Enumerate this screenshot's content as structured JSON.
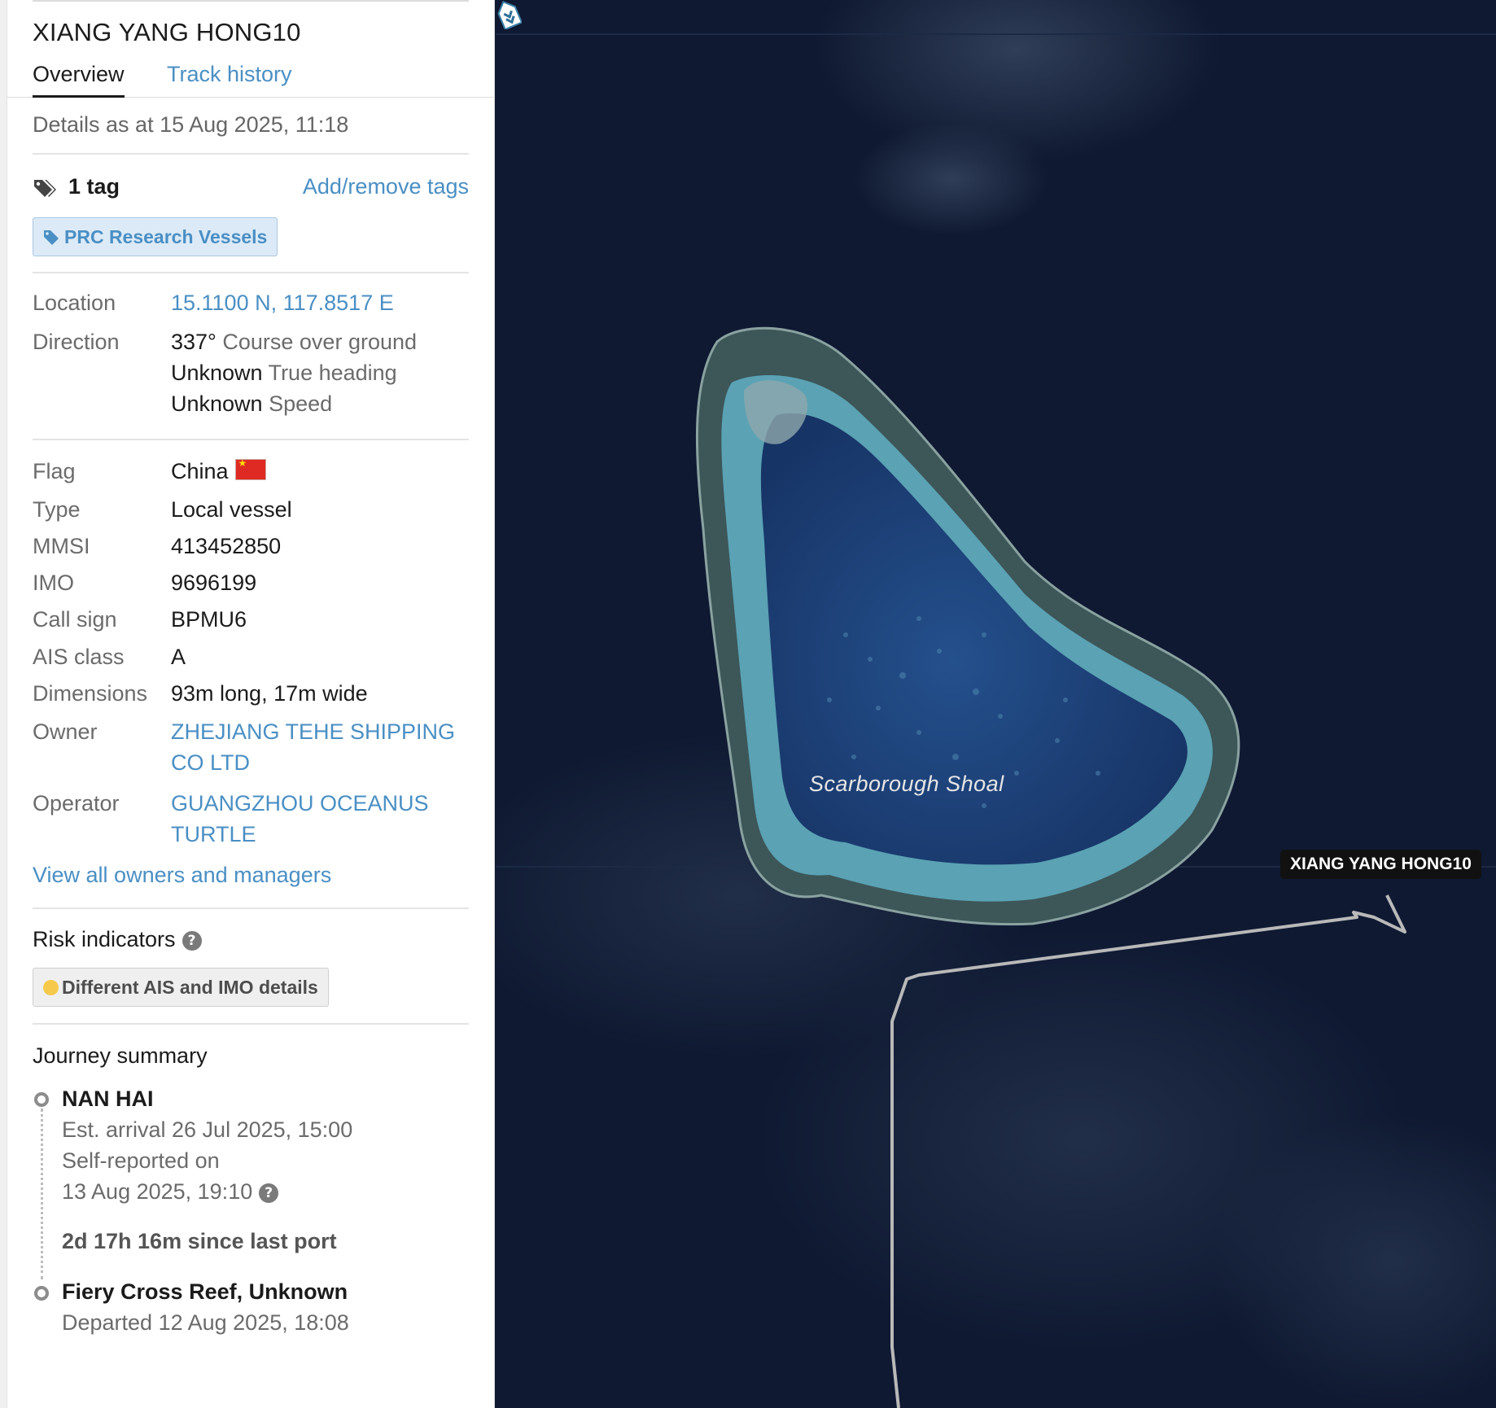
{
  "vessel": {
    "name": "XIANG YANG HONG10"
  },
  "tabs": [
    {
      "label": "Overview",
      "active": true
    },
    {
      "label": "Track history",
      "active": false
    }
  ],
  "details_as": "Details as at 15 Aug 2025, 11:18",
  "tags": {
    "count_label": "1 tag",
    "manage_link": "Add/remove tags",
    "items": [
      "PRC Research Vessels"
    ],
    "icon": "tag-icon"
  },
  "location": {
    "label": "Location",
    "value": "15.1100 N, 117.8517 E"
  },
  "direction": {
    "label": "Direction",
    "course_value": "337°",
    "course_label": "Course over ground",
    "heading_value": "Unknown",
    "heading_label": "True heading",
    "speed_value": "Unknown",
    "speed_label": "Speed"
  },
  "particulars": {
    "flag_label": "Flag",
    "flag_value": "China",
    "type_label": "Type",
    "type_value": "Local vessel",
    "mmsi_label": "MMSI",
    "mmsi_value": "413452850",
    "imo_label": "IMO",
    "imo_value": "9696199",
    "callsign_label": "Call sign",
    "callsign_value": "BPMU6",
    "ais_label": "AIS class",
    "ais_value": "A",
    "dimensions_label": "Dimensions",
    "dimensions_value": "93m long, 17m wide",
    "owner_label": "Owner",
    "owner_line1": "ZHEJIANG TEHE SHIPPING",
    "owner_line2": "CO LTD",
    "operator_label": "Operator",
    "operator_line1": "GUANGZHOU OCEANUS",
    "operator_line2": "TURTLE",
    "view_all": "View all owners and managers"
  },
  "risk": {
    "title": "Risk indicators",
    "help_glyph": "?",
    "indicators": [
      {
        "label": "Different AIS and IMO details",
        "color": "#f6c94c"
      }
    ]
  },
  "journey": {
    "title": "Journey summary",
    "destination": {
      "name": "NAN HAI",
      "eta": "Est. arrival 26 Jul 2025, 15:00",
      "self_reported_prefix": "Self-reported on",
      "self_reported_date": "13 Aug 2025, 19:10"
    },
    "since_last_port": "2d 17h 16m since last port",
    "origin": {
      "name": "Fiery Cross Reef, Unknown",
      "departed": "Departed 12 Aug 2025, 18:08"
    }
  },
  "map": {
    "feature_label": "Scarborough Shoal",
    "vessel_tag": "XIANG YANG HONG10",
    "colors": {
      "ocean": "#0e1830",
      "reef_rim": "#4c6d73",
      "lagoon_edge": "#6fb3c3",
      "lagoon": "#1b3e74",
      "track": "#b9b9b9"
    }
  }
}
